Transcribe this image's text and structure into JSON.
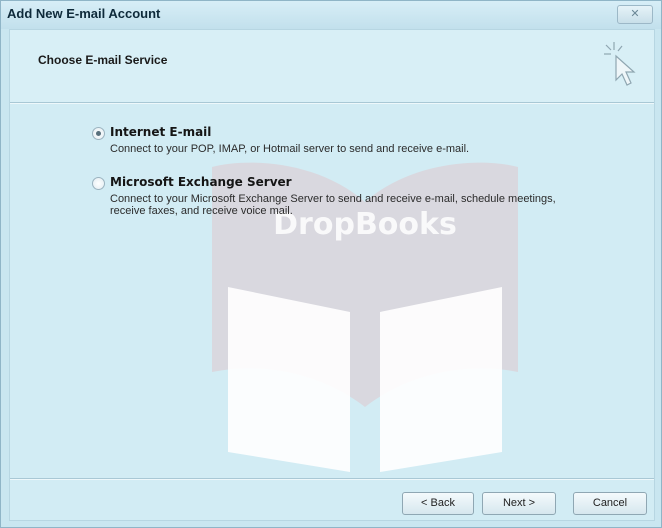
{
  "window": {
    "title": "Add New E-mail Account",
    "close_glyph": "✕"
  },
  "header": {
    "title": "Choose E-mail Service",
    "icon": "cursor-sparkle-icon"
  },
  "options": [
    {
      "label": "Internet E-mail",
      "description": "Connect to your POP, IMAP, or Hotmail server to send and receive e-mail.",
      "selected": true
    },
    {
      "label": "Microsoft Exchange Server",
      "description": "Connect to your Microsoft Exchange Server to send and receive e-mail, schedule meetings, receive faxes, and receive voice mail.",
      "selected": false
    }
  ],
  "buttons": {
    "back": "< Back",
    "next": "Next >",
    "cancel": "Cancel"
  },
  "watermark": {
    "text": "DropBooks",
    "icon": "open-book-icon"
  }
}
